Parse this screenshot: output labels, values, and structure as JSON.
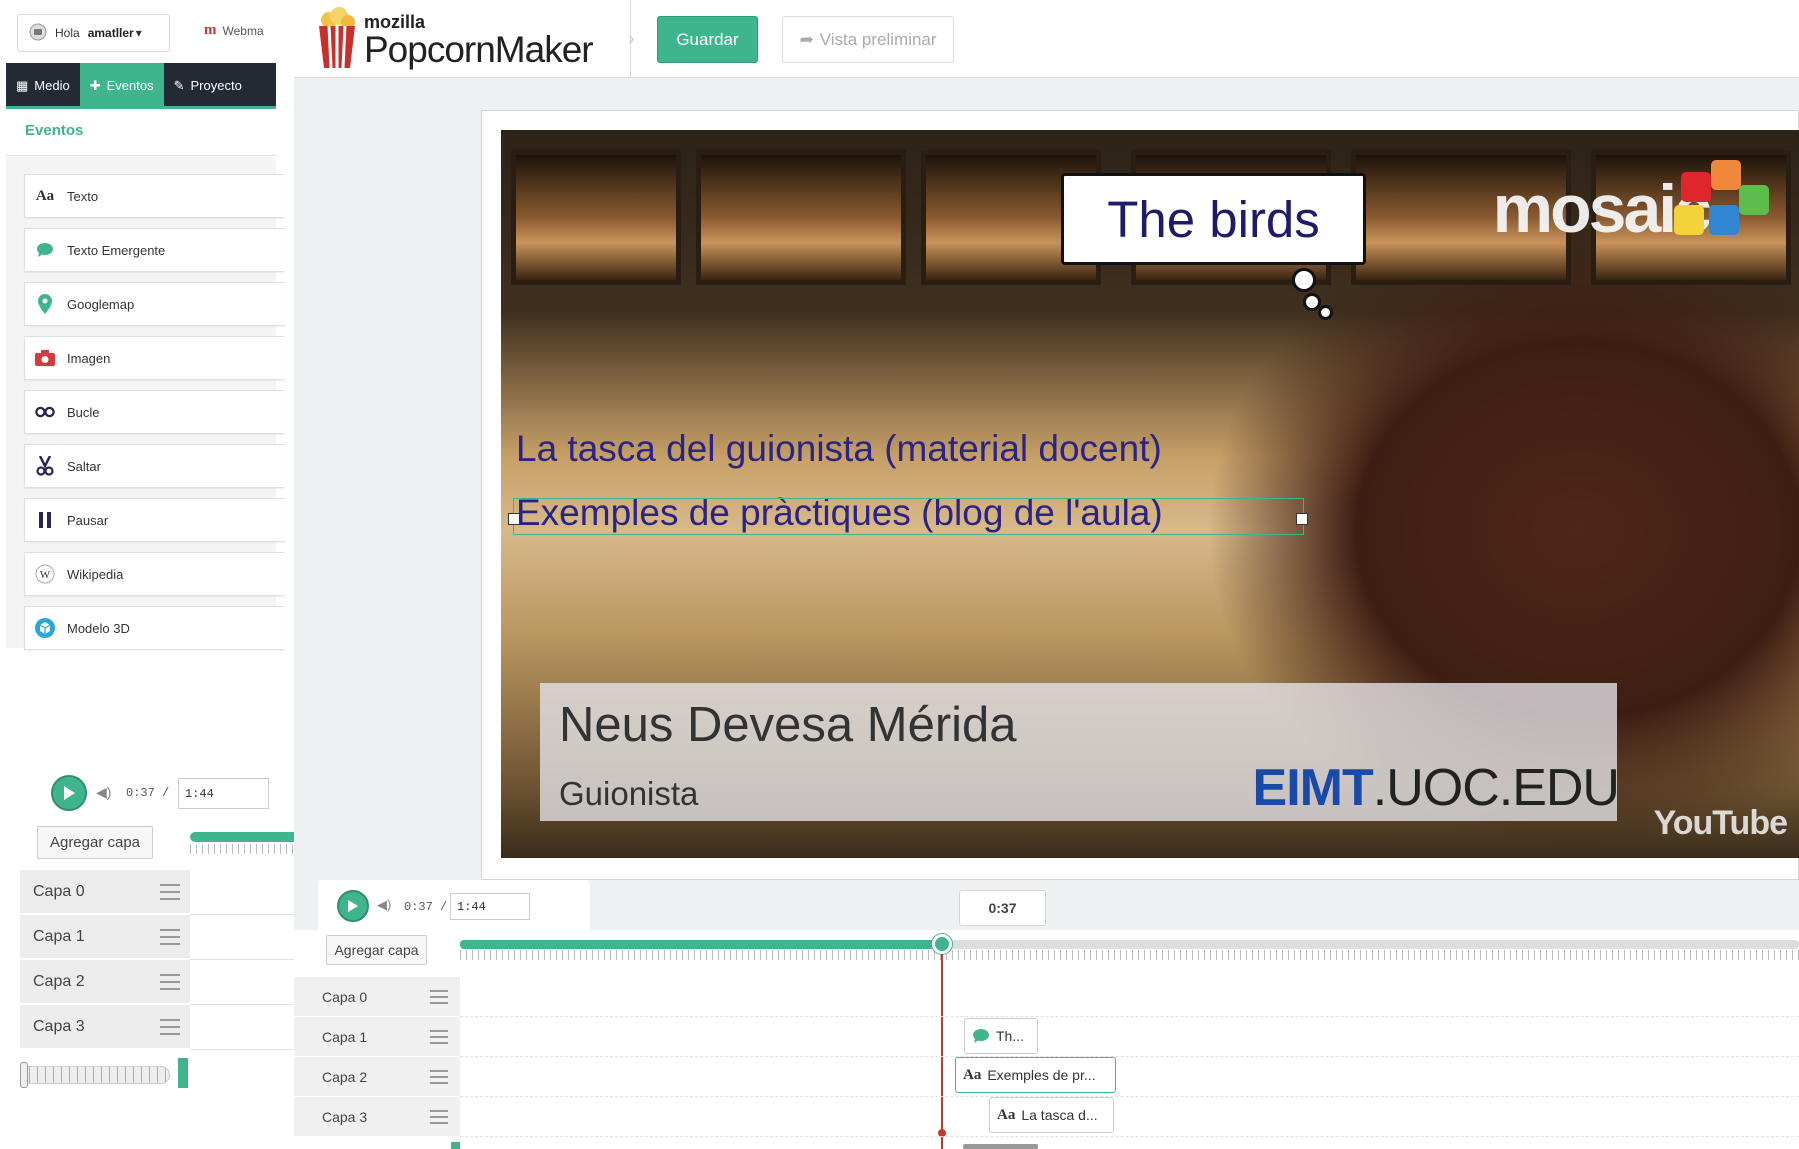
{
  "user": {
    "greeting": "Hola",
    "name": "amatller",
    "caret": "▾"
  },
  "webmaker": {
    "logo": "m",
    "label": "Webma"
  },
  "left_tabs": [
    {
      "label": "Medio",
      "icon": "film-icon"
    },
    {
      "label": "Eventos",
      "icon": "plus-icon"
    },
    {
      "label": "Proyecto",
      "icon": "edit-icon"
    }
  ],
  "events_title": "Eventos",
  "events": [
    {
      "label": "Texto",
      "icon": "text-aa-icon"
    },
    {
      "label": "Texto Emergente",
      "icon": "speech-bubble-icon"
    },
    {
      "label": "Googlemap",
      "icon": "map-pin-icon"
    },
    {
      "label": "Imagen",
      "icon": "camera-icon"
    },
    {
      "label": "Bucle",
      "icon": "loop-icon"
    },
    {
      "label": "Saltar",
      "icon": "skip-icon"
    },
    {
      "label": "Pausar",
      "icon": "pause-icon"
    },
    {
      "label": "Wikipedia",
      "icon": "wikipedia-icon"
    },
    {
      "label": "Modelo 3D",
      "icon": "cube-icon"
    }
  ],
  "header": {
    "logo_small": "mozilla",
    "logo_big": "PopcornMaker",
    "save_label": "Guardar",
    "preview_label": "Vista preliminar"
  },
  "player": {
    "current_time": "0:37",
    "separator": "/",
    "duration": "1:44"
  },
  "timeline": {
    "add_layer_label": "Agregar capa",
    "current_marker": "0:37",
    "progress": 0.36,
    "layers": [
      "Capa 0",
      "Capa 1",
      "Capa 2",
      "Capa 3"
    ],
    "events": [
      {
        "layer": 1,
        "label": "Th...",
        "icon": "speech-bubble-icon"
      },
      {
        "layer": 2,
        "label": "Exemples de pr...",
        "icon": "text-aa-icon"
      },
      {
        "layer": 3,
        "label": "La tasca d...",
        "icon": "text-aa-icon"
      }
    ]
  },
  "video": {
    "bubble_text": "The birds",
    "overlay_line_1": "La tasca del guionista (material docent)",
    "overlay_line_2": "Exemples de pràctiques (blog de l'aula)",
    "lower_third_name": "Neus Devesa Mérida",
    "lower_third_role": "Guionista",
    "site_bold": "EIMT",
    "site_rest": ".UOC.EDU",
    "brand": "mosaic",
    "youtube_mark": "YouTube"
  },
  "colors": {
    "accent": "#3fb58e",
    "dark_nav": "#222a33",
    "overlay_text": "#2a2585"
  }
}
